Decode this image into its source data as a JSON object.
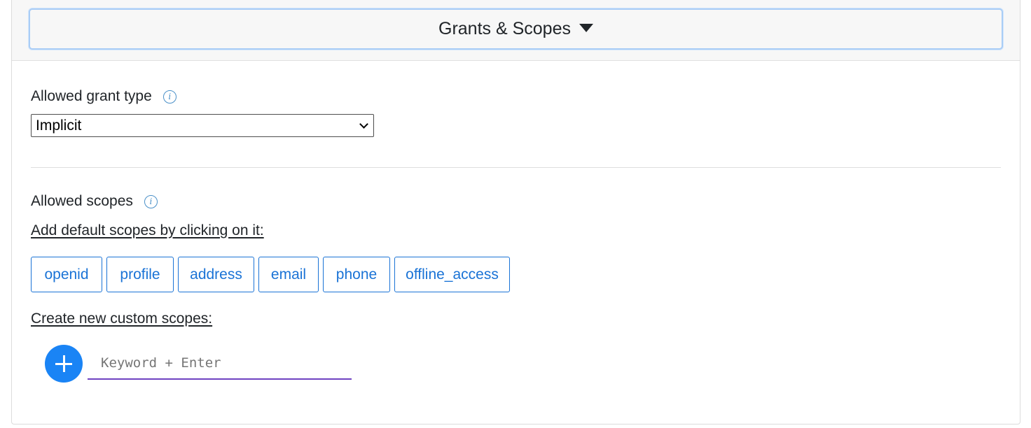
{
  "header": {
    "title": "Grants & Scopes"
  },
  "grant_type": {
    "label": "Allowed grant type",
    "selected": "Implicit"
  },
  "scopes": {
    "label": "Allowed scopes",
    "default_hint": "Add default scopes by clicking on it:",
    "defaults": [
      "openid",
      "profile",
      "address",
      "email",
      "phone",
      "offline_access"
    ],
    "custom_hint": "Create new custom scopes:",
    "input_placeholder": "Keyword + Enter"
  },
  "colors": {
    "accent": "#1a73d6",
    "add_button": "#1a84f5",
    "input_underline": "#6f42c1",
    "info_icon": "#4a90c8"
  },
  "icons": {
    "header_caret": "caret-down-icon",
    "info": "info-icon",
    "select_chevron": "chevron-down-icon",
    "add": "plus-icon"
  }
}
